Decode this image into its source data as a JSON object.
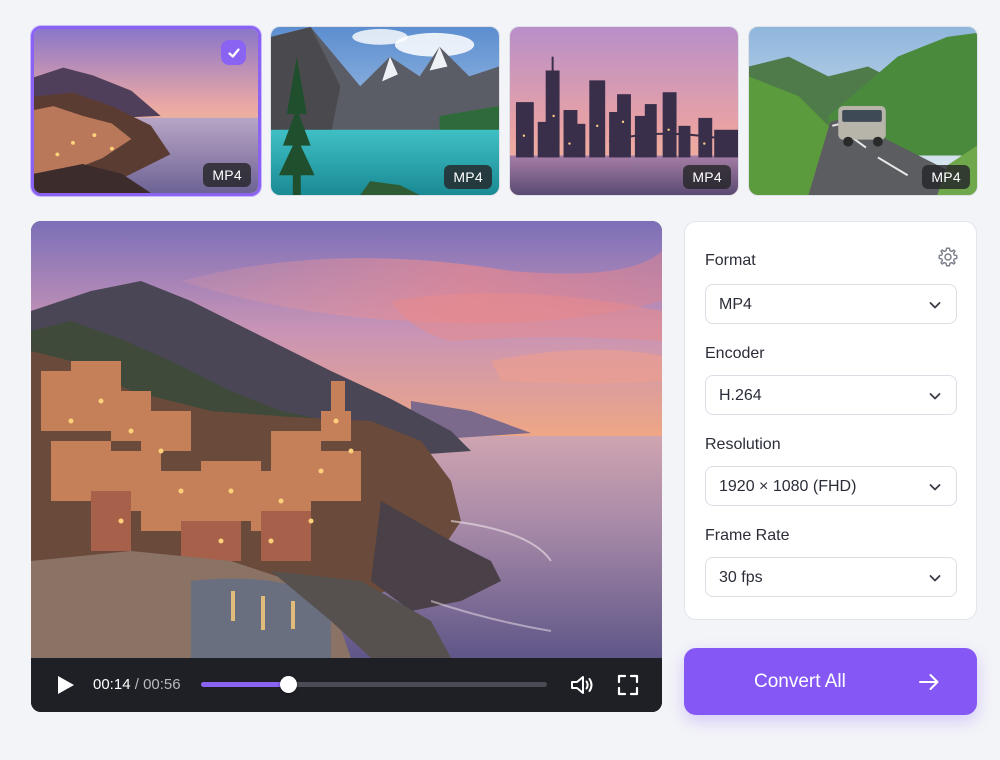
{
  "thumbnails": [
    {
      "badge": "MP4",
      "selected": true,
      "scene": "coastal-village-sunset"
    },
    {
      "badge": "MP4",
      "selected": false,
      "scene": "mountain-lake"
    },
    {
      "badge": "MP4",
      "selected": false,
      "scene": "city-skyline-dusk"
    },
    {
      "badge": "MP4",
      "selected": false,
      "scene": "valley-road-van"
    }
  ],
  "player": {
    "current_time": "00:14",
    "separator": "/",
    "duration": "00:56",
    "progress": 0.25,
    "icons": {
      "play": "play-icon",
      "volume": "volume-icon",
      "fullscreen": "fullscreen-icon"
    }
  },
  "settings": {
    "fields": {
      "format": {
        "label": "Format",
        "value": "MP4"
      },
      "encoder": {
        "label": "Encoder",
        "value": "H.264"
      },
      "resolution": {
        "label": "Resolution",
        "value": "1920 × 1080 (FHD)"
      },
      "frame_rate": {
        "label": "Frame Rate",
        "value": "30 fps"
      }
    }
  },
  "convert_button": {
    "label": "Convert All"
  },
  "colors": {
    "accent": "#8558f5",
    "selected_border": "#8b63f2",
    "background": "#f3f4f8"
  }
}
